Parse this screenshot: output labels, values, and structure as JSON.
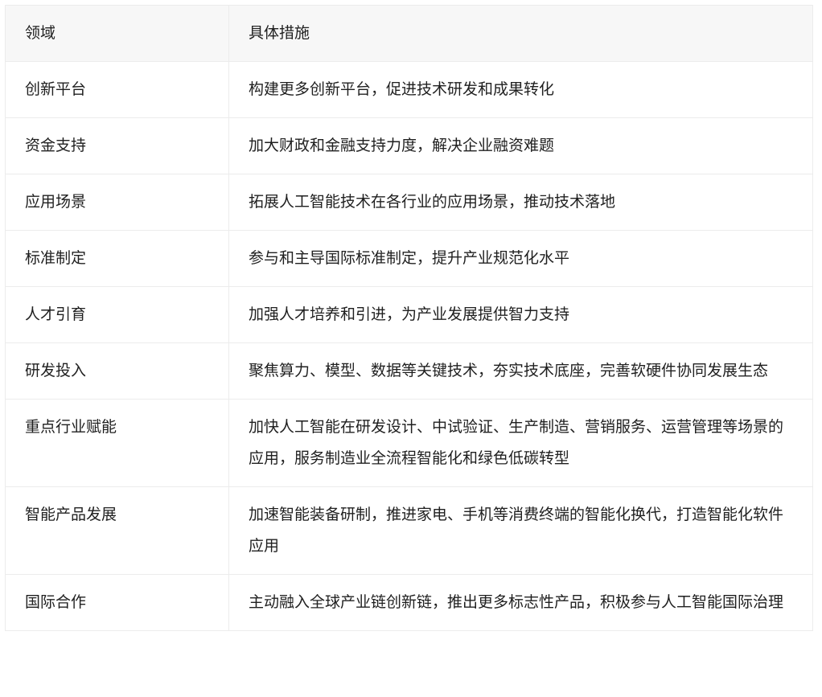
{
  "table": {
    "headers": [
      "领域",
      "具体措施"
    ],
    "rows": [
      {
        "domain": "创新平台",
        "measure": "构建更多创新平台，促进技术研发和成果转化"
      },
      {
        "domain": "资金支持",
        "measure": "加大财政和金融支持力度，解决企业融资难题"
      },
      {
        "domain": "应用场景",
        "measure": "拓展人工智能技术在各行业的应用场景，推动技术落地"
      },
      {
        "domain": "标准制定",
        "measure": "参与和主导国际标准制定，提升产业规范化水平"
      },
      {
        "domain": "人才引育",
        "measure": "加强人才培养和引进，为产业发展提供智力支持"
      },
      {
        "domain": "研发投入",
        "measure": "聚焦算力、模型、数据等关键技术，夯实技术底座，完善软硬件协同发展生态"
      },
      {
        "domain": "重点行业赋能",
        "measure": "加快人工智能在研发设计、中试验证、生产制造、营销服务、运营管理等场景的应用，服务制造业全流程智能化和绿色低碳转型"
      },
      {
        "domain": "智能产品发展",
        "measure": "加速智能装备研制，推进家电、手机等消费终端的智能化换代，打造智能化软件应用"
      },
      {
        "domain": "国际合作",
        "measure": "主动融入全球产业链创新链，推出更多标志性产品，积极参与人工智能国际治理"
      }
    ]
  }
}
